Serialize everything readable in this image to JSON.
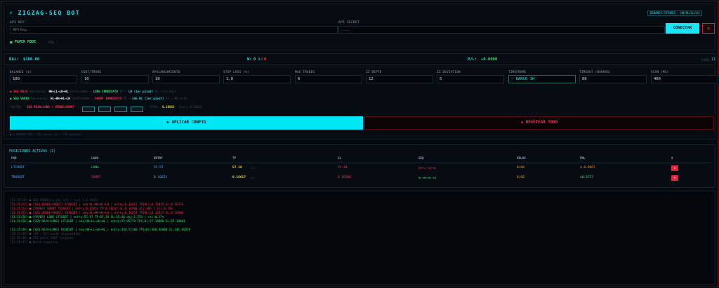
{
  "header": {
    "title": "⚡ ZIGZAG-SEQ BOT",
    "exchange_badge": "BINANCE FUTURES · HH/HL/LL/LH",
    "api_key_label": "API KEY",
    "api_key_placeholder": "API Key...",
    "api_secret_label": "API SECRET",
    "api_secret_placeholder": "........",
    "connect_label": "CONECTAR",
    "close_label": "✕",
    "paper_mode_label": "PAPER MODE",
    "ping_label": "PING —"
  },
  "status": {
    "bal_label": "BAL:",
    "bal_value": "$100.00",
    "w_label": "W:",
    "w_value": "0",
    "l_label": "L:",
    "l_value": "0",
    "pl_label": "P/L:",
    "pl_value": "+0.0000",
    "scans_label": "SCANS:",
    "scans_value": "11"
  },
  "config": {
    "fields": [
      {
        "label": "BALANCE ($)",
        "value": "100"
      },
      {
        "label": "USDT/TRADE",
        "value": "10"
      },
      {
        "label": "APALANCAMIENTO",
        "value": "10"
      },
      {
        "label": "STOP LOSS (%)",
        "value": "1,0"
      },
      {
        "label": "MAX TRADES",
        "value": "6"
      },
      {
        "label": "ZZ DEPTH",
        "value": "12"
      },
      {
        "label": "ZZ DEVIATION",
        "value": "5"
      },
      {
        "label": "TIMEFRAME",
        "value": "— RANGO 1H"
      },
      {
        "label": "TIMEOUT (BARRAS)",
        "value": "60"
      },
      {
        "label": "SCAN (MS)",
        "value": "400"
      }
    ],
    "rules": [
      {
        "tag": "● SEQ ROJA",
        "pre": "Secuencia:",
        "seq": "HH→LL→LH→HL",
        "mid": "Confirmado →",
        "action": "LONG INMEDIATO",
        "tp_pre": "TP →",
        "tp": "LH (1er pivot)",
        "sl": "SL → LL bajo"
      },
      {
        "tag": "● SEQ VERDE",
        "pre": "Secuencia:",
        "seq": "HL→HH→HL→LH",
        "mid": "Confirmado →",
        "action": "SHORT INMEDIATO",
        "tp_pre": "TP →",
        "tp": "2do HL (1er pivot)",
        "sl": "SL → HH alto"
      }
    ],
    "filter_label": "FILTRO:",
    "filter_value": "SEQ ROJA=LONG + VERDE=SHORT",
    "toggles": [
      "",
      "",
      "",
      ""
    ],
    "total_label": "TOTAL:",
    "total_value": "0.16015",
    "entry_label": "entry 0.16015",
    "apply_label": "▶ APLICAR CONFIG",
    "reset_label": "↺ RESETEAR TODO",
    "note": "● 1 ORDERS TOT · 552 pares (10 / 170 activos)"
  },
  "positions": {
    "title": "POSICIONES ACTIVAS (2)",
    "columns": [
      "PAR",
      "LADO",
      "ENTRY",
      "TP",
      "SL",
      "SEQ",
      "VELAS",
      "PNL",
      "X"
    ],
    "rows": [
      {
        "par": "LTCUSDT",
        "lado": "LONG",
        "entry": "55.97",
        "tp": "57.18",
        "tp_sub": "+2%",
        "sl": "55.40",
        "seq": "HH→LL→LH→HL",
        "velas": "0/60",
        "pnl": "$-0.0967",
        "x": "✕"
      },
      {
        "par": "TRXUSDT",
        "lado": "SHORT",
        "entry": "0.16653",
        "tp": "0.16617",
        "tp_sub": "H/L",
        "sl": "0.16908",
        "seq": "HL→HH→HL→LH",
        "velas": "0/60",
        "pnl": "$0.0757",
        "x": "✕"
      }
    ]
  },
  "log": {
    "lines": [
      {
        "c": "dim",
        "t": "[13:35:28] ■ SEQ VERDE(LL→LH) 3/4 · (vol 1.6 PASO)"
      },
      {
        "c": "red",
        "t": "[13:35:53] ■ [SEQ VERDE→SHORT] XCNUSDT | seq:HL→HH→HL→LH | entry:0.16015 TP[HL]:0.15815 SL:0.16378"
      },
      {
        "c": "red",
        "t": "[13:35:53] ■ [PAPER] SHORT TRXUSDT | entry:0.16653 TP:0.16617 SL:0.16908 qty:309 | rsi:0.35%"
      },
      {
        "c": "red",
        "t": "[13:35:53] ■ [SEQ VERDE→SHORT] TRXUSDT | seq:HL→HH→HL→LH | entry:0.16653 TP[HL]:0.16617 SL:0.16908"
      },
      {
        "c": "green",
        "t": "[13:35:58] ■ [PAPER] LONG LTCUSDT | entry:55.97 TP:57.18 SL:55.40 qty:1.753 | rsi:0.17%"
      },
      {
        "c": "green",
        "t": "[13:35:58] ■ [SEQ ROJA→LONG] LTCUSDT | seq:HH→LL→LH→HL | entry:55.95779 TP[LH]:57.18000 SL:55.39881"
      },
      {
        "c": "blank",
        "t": ""
      },
      {
        "c": "green",
        "t": "[13:35:49] ■ [SEQ ROJA→LONG] BCHUSDT | seq:HH→LL→LH→HL | entry:450.57100 TP[LH]:460.96000 SL:441.00529"
      },
      {
        "c": "dim",
        "t": "[13:35:48] ■ ~19 → 552 pares disponibles"
      },
      {
        "c": "dim",
        "t": "[13:35:48] ■ 552 pares USDT cargados"
      },
      {
        "c": "dim",
        "t": "[13:35:47] ■ Reset completo"
      }
    ]
  }
}
